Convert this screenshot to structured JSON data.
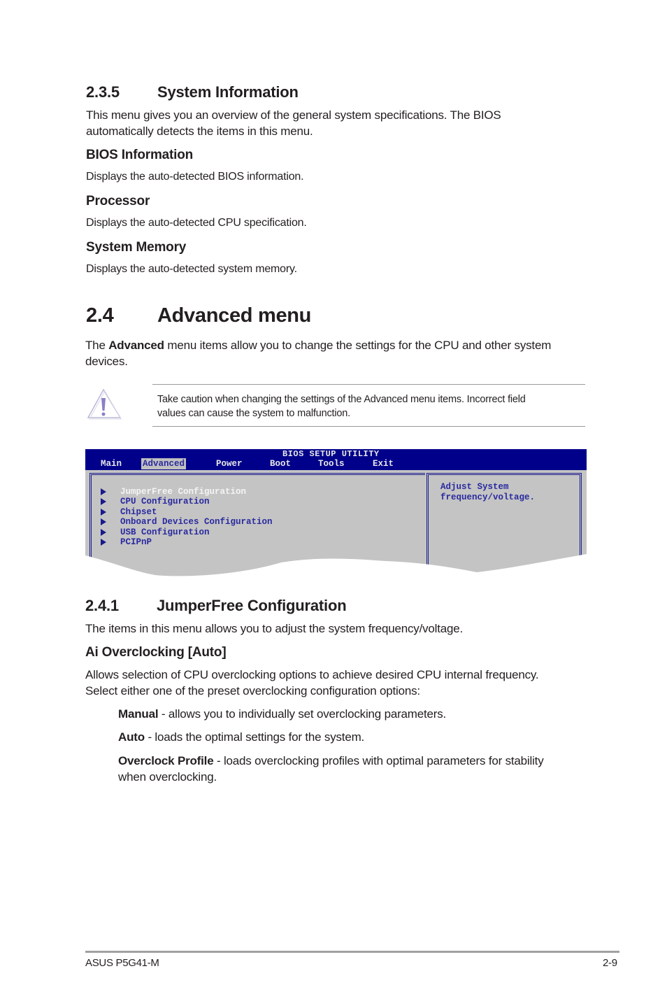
{
  "section_235": {
    "number": "2.3.5",
    "title": "System Information",
    "intro_line1": "This menu gives you an overview of the general system specifications. The BIOS",
    "intro_line2": "automatically detects the items in this menu.",
    "items": [
      {
        "heading": "BIOS Information",
        "text": "Displays the auto-detected BIOS information."
      },
      {
        "heading": "Processor",
        "text": "Displays the auto-detected CPU specification."
      },
      {
        "heading": "System Memory",
        "text": "Displays the auto-detected system memory."
      }
    ]
  },
  "section_24": {
    "number": "2.4",
    "title": "Advanced menu",
    "intro_pre": "The ",
    "intro_bold": "Advanced",
    "intro_post": " menu items allow you to change the settings for the CPU and other system",
    "intro_line2": "devices.",
    "caution": {
      "icon": "warning-icon",
      "line1": "Take caution when changing the settings of the Advanced menu items. Incorrect field",
      "line2": "values can cause the system to malfunction."
    }
  },
  "bios": {
    "title": "BIOS SETUP UTILITY",
    "menu": [
      "Main",
      "Advanced",
      "Power",
      "Boot",
      "Tools",
      "Exit"
    ],
    "active_menu": "Advanced",
    "items": [
      "JumperFree Configuration",
      "CPU Configuration",
      "Chipset",
      "Onboard Devices Configuration",
      "USB Configuration",
      "PCIPnP"
    ],
    "selected_item": "JumperFree Configuration",
    "help_line1": "Adjust System",
    "help_line2": "frequency/voltage.",
    "colors": {
      "bar": "#00008b",
      "panel": "#c4c4c4",
      "text": "#2a2aa0",
      "selected": "#f4f4f4"
    }
  },
  "section_241": {
    "number": "2.4.1",
    "title": "JumperFree Configuration",
    "intro": "The items in this menu allows you to adjust the system frequency/voltage.",
    "setting_heading": "Ai Overclocking [Auto]",
    "setting_line1": "Allows selection of CPU overclocking options to achieve desired CPU internal frequency.",
    "setting_line2": "Select either one of the preset overclocking configuration options:",
    "options": [
      {
        "name": "Manual",
        "desc": " - allows you to individually set overclocking parameters."
      },
      {
        "name": "Auto",
        "desc": " - loads the optimal settings for the system."
      },
      {
        "name": "Overclock Profile",
        "desc": " - loads overclocking profiles with optimal parameters for stability",
        "desc_line2": "when overclocking."
      }
    ]
  },
  "footer": {
    "product": "ASUS P5G41-M",
    "page": "2-9"
  }
}
